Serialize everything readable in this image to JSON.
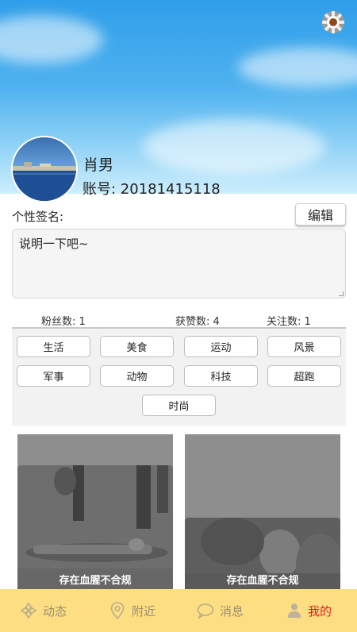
{
  "profile": {
    "name": "肖男",
    "account": "账号: 20181415118"
  },
  "signature": {
    "label": "个性签名:",
    "edit_label": "编辑",
    "value": "说明一下吧~"
  },
  "stats": {
    "fans": "粉丝数: 1",
    "likes": "获赞数: 4",
    "follows": "关注数: 1"
  },
  "tags": [
    "生活",
    "美食",
    "运动",
    "风景",
    "军事",
    "动物",
    "科技",
    "超跑",
    "时尚"
  ],
  "feed": [
    {
      "warning": "存在血腥不合规"
    },
    {
      "warning": "存在血腥不合规"
    }
  ],
  "tabbar": {
    "items": [
      {
        "label": "动态",
        "icon": "moments-icon"
      },
      {
        "label": "附近",
        "icon": "location-pin-icon"
      },
      {
        "label": "消息",
        "icon": "message-bubble-icon"
      },
      {
        "label": "我的",
        "icon": "person-icon",
        "active": true
      }
    ],
    "active_color": "#d8221b",
    "background": "#fdde82"
  }
}
